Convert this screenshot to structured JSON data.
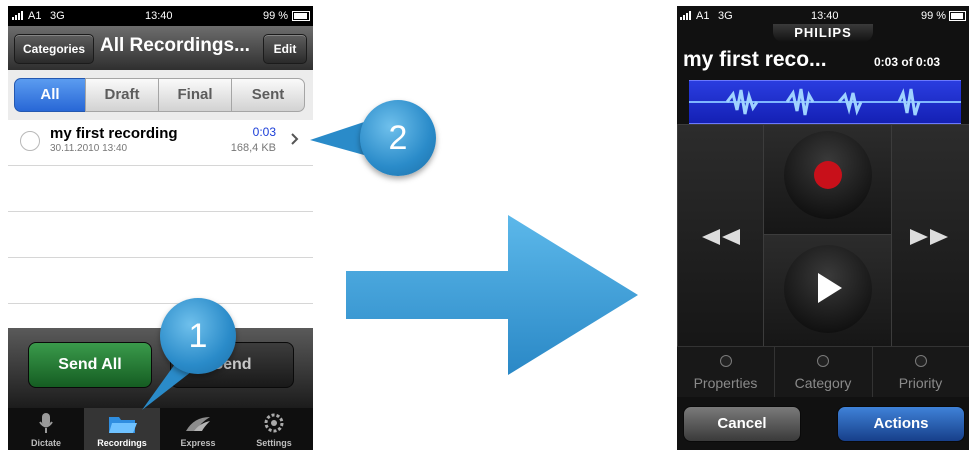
{
  "left_phone": {
    "status": {
      "carrier": "A1",
      "network": "3G",
      "time": "13:40",
      "battery": "99 %"
    },
    "nav": {
      "back_label": "Categories",
      "title": "All Recordings...",
      "edit_label": "Edit"
    },
    "segments": [
      {
        "label": "All",
        "active": true
      },
      {
        "label": "Draft",
        "active": false
      },
      {
        "label": "Final",
        "active": false
      },
      {
        "label": "Sent",
        "active": false
      }
    ],
    "recordings": [
      {
        "name": "my first recording",
        "date": "30.11.2010 13:40",
        "duration": "0:03",
        "size": "168,4 KB"
      }
    ],
    "buttons": {
      "send_all": "Send All",
      "send": "Send"
    },
    "tabs": [
      {
        "label": "Dictate",
        "icon": "microphone-icon",
        "active": false
      },
      {
        "label": "Recordings",
        "icon": "folder-icon",
        "active": true
      },
      {
        "label": "Express",
        "icon": "express-icon",
        "active": false
      },
      {
        "label": "Settings",
        "icon": "gear-icon",
        "active": false
      }
    ]
  },
  "callouts": {
    "step1": "1",
    "step2": "2"
  },
  "right_phone": {
    "status": {
      "carrier": "A1",
      "network": "3G",
      "time": "13:40",
      "battery": "99 %"
    },
    "brand": "PHILIPS",
    "title": "my first reco...",
    "position": "0:03",
    "of_label": "of",
    "total": "0:03",
    "indicators": [
      {
        "label": "Properties"
      },
      {
        "label": "Category"
      },
      {
        "label": "Priority"
      }
    ],
    "buttons": {
      "cancel": "Cancel",
      "actions": "Actions"
    }
  },
  "colors": {
    "accent_blue": "#2a8bc9",
    "record_red": "#c8101a",
    "send_green": "#1f7a2e",
    "actions_blue": "#1d5fb4",
    "waveform_bg": "#1c2fd6"
  }
}
